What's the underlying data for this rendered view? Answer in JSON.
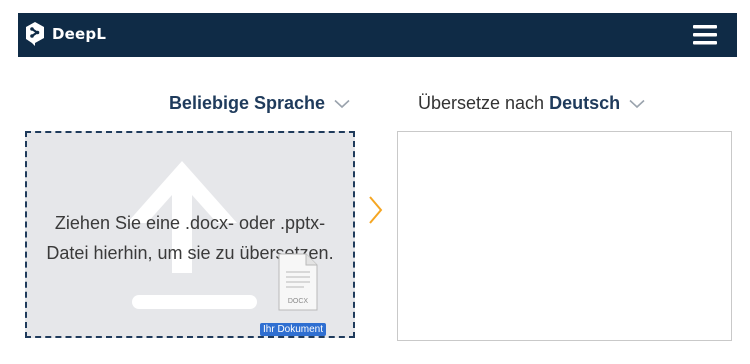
{
  "app": {
    "brand_name": "DeepL"
  },
  "languages": {
    "source_label": "Beliebige Sprache",
    "target_prefix": "Übersetze nach",
    "target_label": "Deutsch"
  },
  "dropzone": {
    "line1": "Ziehen Sie eine .docx- oder .pptx-",
    "line2": "Datei hierhin, um sie zu übersetzen.",
    "file_type": "DOCX",
    "badge": "Ihr Dokument"
  },
  "icons": {
    "logo": "deepl-logo-icon",
    "menu": "hamburger-menu-icon",
    "chevron": "chevron-down-icon",
    "upload": "upload-arrow-icon",
    "document": "document-file-icon",
    "translate_arrow": "chevron-right-icon"
  },
  "colors": {
    "header_bg": "#0f2b46",
    "brand_text": "#1f3b5c",
    "accent_orange": "#f5a623",
    "badge_blue": "#2f6fd1",
    "dropzone_bg": "#e6e7ea"
  }
}
